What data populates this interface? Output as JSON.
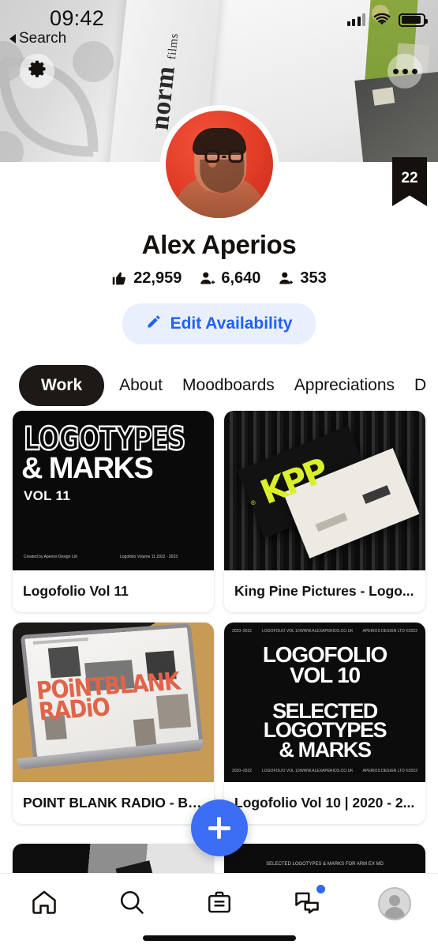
{
  "status_bar": {
    "time": "09:42",
    "back_label": "Search",
    "signal_icon": "cellular-signal-icon",
    "wifi_icon": "wifi-icon",
    "battery_icon": "battery-icon"
  },
  "cover": {
    "settings_icon": "gear-icon",
    "more_icon": "more-options-icon",
    "artwork_text": "norm",
    "artwork_subtext": "films"
  },
  "profile": {
    "name": "Alex Aperios",
    "avatar_name": "profile-avatar",
    "project_count_badge": "22",
    "stats": [
      {
        "icon": "thumbs-up-icon",
        "value": "22,959"
      },
      {
        "icon": "followers-icon",
        "value": "6,640"
      },
      {
        "icon": "following-icon",
        "value": "353"
      }
    ],
    "edit_availability": {
      "label": "Edit Availability",
      "icon": "pencil-icon",
      "text_color": "#2161f6",
      "bg_color": "#e9effd"
    }
  },
  "tabs": [
    {
      "label": "Work",
      "active": true
    },
    {
      "label": "About",
      "active": false
    },
    {
      "label": "Moodboards",
      "active": false
    },
    {
      "label": "Appreciations",
      "active": false
    },
    {
      "label": "D",
      "active": false
    }
  ],
  "projects": [
    {
      "title": "Logofolio Vol 11",
      "thumb": {
        "line1": "LOGOTYPES",
        "line2": "& MARKS",
        "line3": "VOL 11",
        "credit_left": "Created by\nAperios Design Ltd",
        "credit_right": "Logofolio Volume 11\n2022 - 2023"
      }
    },
    {
      "title": "King Pine Pictures - Logo...",
      "thumb": {
        "mark": "KPP",
        "registered": "®"
      }
    },
    {
      "title": "POINT BLANK RADIO - BR...",
      "thumb": {
        "line1": "POiNTBLANK",
        "line2": "RADiO"
      }
    },
    {
      "title": "Logofolio Vol 10 | 2020 - 2...",
      "thumb": {
        "line1": "LOGOFOLIO",
        "line2": "VOL 10",
        "line3": "SELECTED",
        "line4": "LOGOTYPES",
        "line5": "& MARKS",
        "meta1": "2020–2022",
        "meta2": "LOGOFOLIO\nVOL 10",
        "meta3": "WWW.ALEXAPERIOS.CO.UK",
        "meta4": "APERIOS DESIGN\nLTD ©2022"
      }
    }
  ],
  "partial_projects": [
    {
      "name": "partial-card-left"
    },
    {
      "name": "partial-card-right",
      "thumb_text": "SELECTED LOGOTYPES\n& MARKS FOR ARM EX MD"
    }
  ],
  "fab": {
    "icon": "plus-icon",
    "color": "#3b6df5"
  },
  "bottom_nav": [
    {
      "icon": "home-icon",
      "active": true,
      "badge": false
    },
    {
      "icon": "search-icon",
      "active": false,
      "badge": false
    },
    {
      "icon": "jobs-briefcase-icon",
      "active": false,
      "badge": false
    },
    {
      "icon": "messages-icon",
      "active": false,
      "badge": true
    },
    {
      "icon": "profile-avatar-icon",
      "active": false,
      "badge": false
    }
  ]
}
